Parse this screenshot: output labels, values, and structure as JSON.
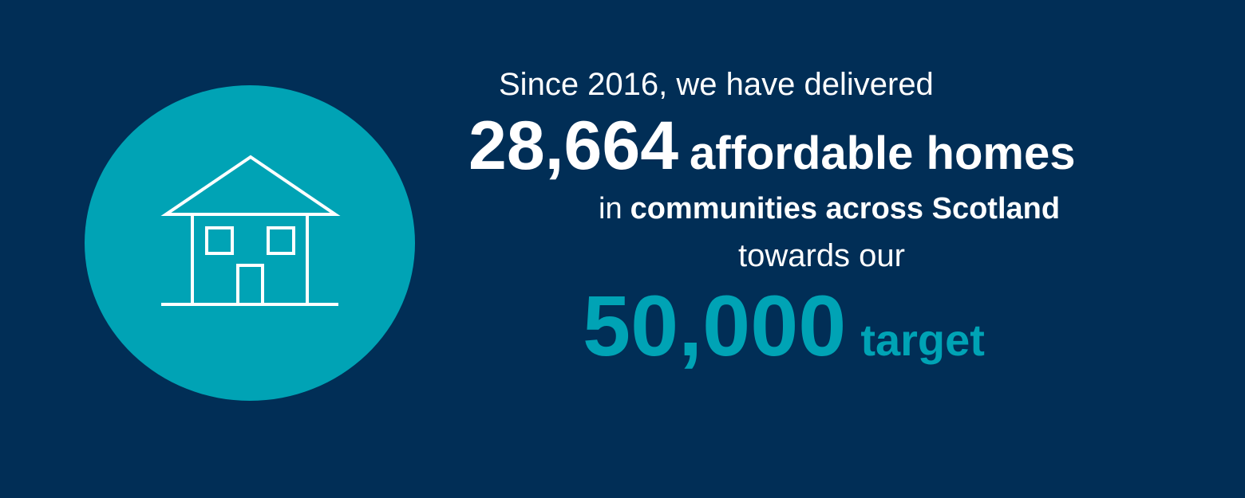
{
  "headline": {
    "intro": "Since 2016, we have delivered",
    "delivered_number": "28,664",
    "delivered_label": "affordable homes",
    "location_prefix": "in",
    "location_bold": "communities across Scotland",
    "connector": "towards our",
    "target_number": "50,000",
    "target_label": "target"
  },
  "icon": "house-icon",
  "colors": {
    "background": "#012e56",
    "accent": "#00a3b5",
    "text": "#ffffff"
  }
}
